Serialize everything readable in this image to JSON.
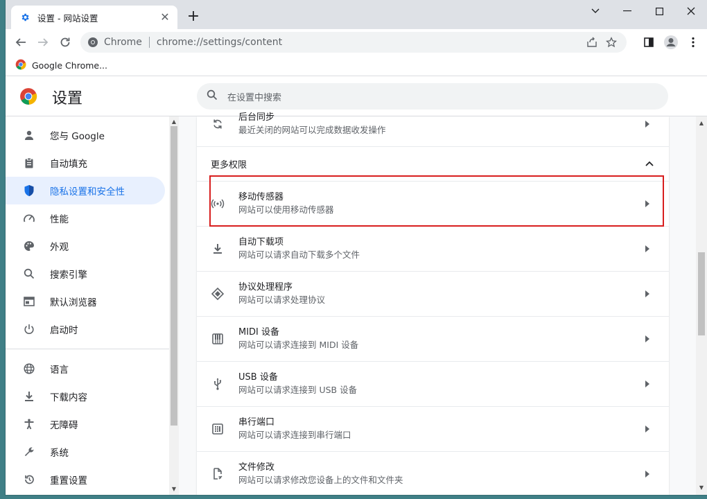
{
  "tab": {
    "title": "设置 - 网站设置",
    "close": "✕",
    "new_tab": "+"
  },
  "toolbar": {
    "site_name": "Chrome",
    "url": "chrome://settings/content"
  },
  "bookmarks": [
    {
      "label": "Google Chrome..."
    }
  ],
  "header": {
    "title": "设置",
    "search_placeholder": "在设置中搜索"
  },
  "sidebar": {
    "items": [
      {
        "label": "您与 Google",
        "icon": "person-icon",
        "active": false
      },
      {
        "label": "自动填充",
        "icon": "clipboard-icon",
        "active": false
      },
      {
        "label": "隐私设置和安全性",
        "icon": "shield-icon",
        "active": true
      },
      {
        "label": "性能",
        "icon": "speedometer-icon",
        "active": false
      },
      {
        "label": "外观",
        "icon": "palette-icon",
        "active": false
      },
      {
        "label": "搜索引擎",
        "icon": "search-icon",
        "active": false
      },
      {
        "label": "默认浏览器",
        "icon": "browser-window-icon",
        "active": false
      },
      {
        "label": "启动时",
        "icon": "power-icon",
        "active": false
      }
    ],
    "items2": [
      {
        "label": "语言",
        "icon": "globe-icon"
      },
      {
        "label": "下载内容",
        "icon": "download-icon"
      },
      {
        "label": "无障碍",
        "icon": "accessibility-icon"
      },
      {
        "label": "系统",
        "icon": "wrench-icon"
      },
      {
        "label": "重置设置",
        "icon": "reset-icon"
      }
    ]
  },
  "main": {
    "top_row": {
      "title": "后台同步",
      "subtitle": "最近关闭的网站可以完成数据收发操作",
      "icon": "sync-icon"
    },
    "section_title": "更多权限",
    "rows": [
      {
        "title": "移动传感器",
        "subtitle": "网站可以使用移动传感器",
        "icon": "motion-sensor-icon"
      },
      {
        "title": "自动下载项",
        "subtitle": "网站可以请求自动下载多个文件",
        "icon": "download-icon"
      },
      {
        "title": "协议处理程序",
        "subtitle": "网站可以请求处理协议",
        "icon": "protocol-handler-icon"
      },
      {
        "title": "MIDI 设备",
        "subtitle": "网站可以请求连接到 MIDI 设备",
        "icon": "piano-icon"
      },
      {
        "title": "USB 设备",
        "subtitle": "网站可以请求连接到 USB 设备",
        "icon": "usb-icon"
      },
      {
        "title": "串行端口",
        "subtitle": "网站可以请求连接到串行端口",
        "icon": "serial-port-icon"
      },
      {
        "title": "文件修改",
        "subtitle": "网站可以请求修改您设备上的文件和文件夹",
        "icon": "file-edit-icon"
      }
    ]
  },
  "colors": {
    "accent": "#1a73e8",
    "highlight": "#d81e1e",
    "active_bg": "#e8f0fe"
  }
}
